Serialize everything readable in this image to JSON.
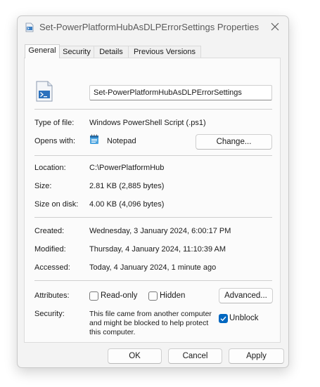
{
  "window": {
    "title": "Set-PowerPlatformHubAsDLPErrorSettings Properties"
  },
  "tabs": [
    {
      "label": "General"
    },
    {
      "label": "Security"
    },
    {
      "label": "Details"
    },
    {
      "label": "Previous Versions"
    }
  ],
  "general": {
    "file_name": "Set-PowerPlatformHubAsDLPErrorSettings",
    "type_of_file_label": "Type of file:",
    "type_of_file": "Windows PowerShell Script (.ps1)",
    "opens_with_label": "Opens with:",
    "opens_with": "Notepad",
    "change_label": "Change...",
    "location_label": "Location:",
    "location": "C:\\PowerPlatformHub",
    "size_label": "Size:",
    "size": "2.81 KB (2,885 bytes)",
    "size_on_disk_label": "Size on disk:",
    "size_on_disk": "4.00 KB (4,096 bytes)",
    "created_label": "Created:",
    "created": "Wednesday, 3 January 2024, 6:00:17 PM",
    "modified_label": "Modified:",
    "modified": "Thursday, 4 January 2024, 11:10:39 AM",
    "accessed_label": "Accessed:",
    "accessed": "Today, 4 January 2024, 1 minute ago",
    "attributes_label": "Attributes:",
    "readonly_label": "Read-only",
    "readonly_checked": false,
    "hidden_label": "Hidden",
    "hidden_checked": false,
    "advanced_label": "Advanced...",
    "security_label": "Security:",
    "security_text_1": "This file came from another computer",
    "security_text_2": "and might be blocked to help protect",
    "security_text_3": "this computer.",
    "unblock_label": "Unblock",
    "unblock_checked": true
  },
  "footer": {
    "ok_label": "OK",
    "cancel_label": "Cancel",
    "apply_label": "Apply"
  },
  "colors": {
    "accent": "#0067c0",
    "panel_bg": "#fbfbfb",
    "window_bg": "#f3f3f3"
  },
  "icons": {
    "title": "powershell-script-icon",
    "file": "powershell-script-icon",
    "opens_with": "notepad-icon",
    "close": "close-icon"
  }
}
